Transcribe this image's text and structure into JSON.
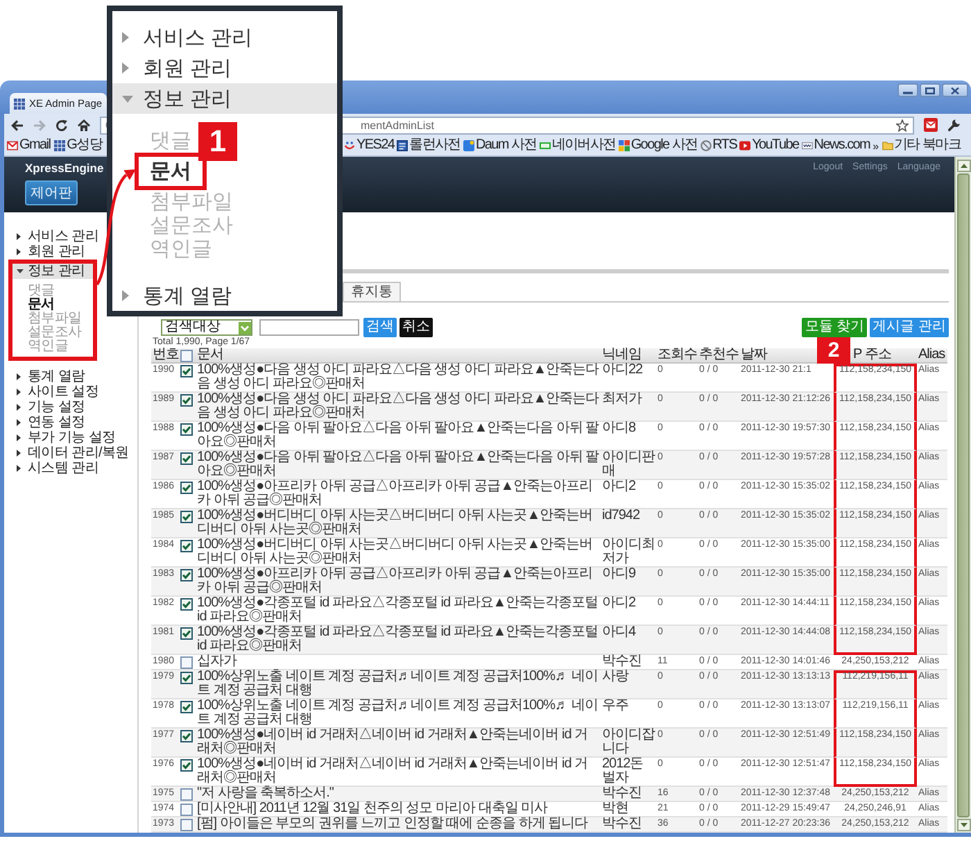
{
  "magnified_menu": {
    "callout": "1",
    "items": [
      {
        "label": "서비스 관리",
        "expanded": false
      },
      {
        "label": "회원 관리",
        "expanded": false
      },
      {
        "label": "정보 관리",
        "expanded": true,
        "children": [
          {
            "label": "댓글",
            "selected": false,
            "highlighted": false
          },
          {
            "label": "문서",
            "selected": true,
            "highlighted": true
          },
          {
            "label": "첨부파일",
            "selected": false,
            "highlighted": false
          },
          {
            "label": "설문조사",
            "selected": false,
            "highlighted": false
          },
          {
            "label": "역인글",
            "selected": false,
            "highlighted": false
          }
        ]
      },
      {
        "label": "통계 열람",
        "expanded": false
      }
    ]
  },
  "browser": {
    "tab_title": "XE Admin Page",
    "address": "mentAdminList",
    "bookmarks_left": [
      {
        "label": "Gmail",
        "kind": "mail"
      },
      {
        "label": "G성당",
        "kind": "grid"
      }
    ],
    "bookmarks_right": [
      {
        "label": "YES24",
        "kind": "smile"
      },
      {
        "label": "롤런사전",
        "kind": "book"
      },
      {
        "label": "Daum 사전",
        "kind": "tile"
      },
      {
        "label": "네이버사전",
        "kind": "bar"
      },
      {
        "label": "Google 사전",
        "kind": "squares"
      },
      {
        "label": "RTS",
        "kind": "ring"
      },
      {
        "label": "YouTube",
        "kind": "play"
      },
      {
        "label": "News.com",
        "kind": "card"
      }
    ],
    "overflow": "»",
    "other_bookmarks": "기타 북마크"
  },
  "header": {
    "logo": "XpressEngine",
    "control_panel_button": "제어판",
    "links": [
      "Logout",
      "Settings",
      "Language"
    ]
  },
  "sidebar": {
    "items": [
      {
        "label": "서비스 관리",
        "expanded": false,
        "highlighted": false
      },
      {
        "label": "회원 관리",
        "expanded": false,
        "highlighted": false
      },
      {
        "label": "정보 관리",
        "expanded": true,
        "highlighted": true,
        "children": [
          {
            "label": "댓글",
            "selected": false
          },
          {
            "label": "문서",
            "selected": true
          },
          {
            "label": "첨부파일",
            "selected": false
          },
          {
            "label": "설문조사",
            "selected": false
          },
          {
            "label": "역인글",
            "selected": false
          }
        ]
      },
      {
        "label": "통계 열람",
        "expanded": false,
        "highlighted": false
      },
      {
        "label": "사이트 설정",
        "expanded": false,
        "highlighted": false
      },
      {
        "label": "기능 설정",
        "expanded": false,
        "highlighted": false
      },
      {
        "label": "연동 설정",
        "expanded": false,
        "highlighted": false
      },
      {
        "label": "부가 기능 설정",
        "expanded": false,
        "highlighted": false
      },
      {
        "label": "데이터 관리/복원",
        "expanded": false,
        "highlighted": false
      },
      {
        "label": "시스템 관리",
        "expanded": false,
        "highlighted": false
      }
    ]
  },
  "content": {
    "tabs": [
      {
        "label": "휴지통",
        "selected": false
      }
    ],
    "search_target": "검색대상",
    "search_button": "검색",
    "cancel_button": "취소",
    "action_buttons": [
      {
        "label": "모듈 찾기",
        "color": "#1f9a1f"
      },
      {
        "label": "게시글 관리",
        "color": "#2b8fe3"
      }
    ],
    "summary": "Total 1,990, Page 1/67"
  },
  "table": {
    "callout": "2",
    "select_all_checked": false,
    "columns": [
      "번호",
      "문서",
      "닉네임",
      "조회수",
      "추천수",
      "날짜",
      "P 주소",
      "Alias"
    ],
    "rows": [
      {
        "number": "1990",
        "checked": true,
        "title": "100%생성●다음 생성 아디 파라요△다음 생성 아디 파라요▲안죽는다음 생성 아디 파라요◎판매처",
        "nickname": "아디22",
        "views": "0",
        "votes": "0 / 0",
        "date": "2011-12-30 21:1",
        "ip": "112,158,234,150",
        "alias": "Alias",
        "ip_highlighted": true
      },
      {
        "number": "1989",
        "checked": true,
        "title": "100%생성●다음 생성 아디 파라요△다음 생성 아디 파라요▲안죽는다음 생성 아디 파라요◎판매처",
        "nickname": "최저가",
        "views": "0",
        "votes": "0 / 0",
        "date": "2011-12-30 21:12:26",
        "ip": "112,158,234,150",
        "alias": "Alias",
        "ip_highlighted": true
      },
      {
        "number": "1988",
        "checked": true,
        "title": "100%생성●다음 아뒤 팔아요△다음 아뒤 팔아요▲안죽는다음 아뒤 팔아요◎판매처",
        "nickname": "아디8",
        "views": "0",
        "votes": "0 / 0",
        "date": "2011-12-30 19:57:30",
        "ip": "112,158,234,150",
        "alias": "Alias",
        "ip_highlighted": true
      },
      {
        "number": "1987",
        "checked": true,
        "title": "100%생성●다음 아뒤 팔아요△다음 아뒤 팔아요▲안죽는다음 아뒤 팔아요◎판매처",
        "nickname": "아이디판매",
        "views": "0",
        "votes": "0 / 0",
        "date": "2011-12-30 19:57:28",
        "ip": "112,158,234,150",
        "alias": "Alias",
        "ip_highlighted": true
      },
      {
        "number": "1986",
        "checked": true,
        "title": "100%생성●아프리카 아뒤 공급△아프리카 아뒤 공급▲안죽는아프리카 아뒤 공급◎판매처",
        "nickname": "아디2",
        "views": "0",
        "votes": "0 / 0",
        "date": "2011-12-30 15:35:02",
        "ip": "112,158,234,150",
        "alias": "Alias",
        "ip_highlighted": true
      },
      {
        "number": "1985",
        "checked": true,
        "title": "100%생성●버디버디 아뒤 사는곳△버디버디 아뒤 사는곳▲안죽는버디버디 아뒤 사는곳◎판매처",
        "nickname": "id7942",
        "views": "0",
        "votes": "0 / 0",
        "date": "2011-12-30 15:35:02",
        "ip": "112,158,234,150",
        "alias": "Alias",
        "ip_highlighted": true
      },
      {
        "number": "1984",
        "checked": true,
        "title": "100%생성●버디버디 아뒤 사는곳△버디버디 아뒤 사는곳▲안죽는버디버디 아뒤 사는곳◎판매처",
        "nickname": "아이디최저가",
        "views": "0",
        "votes": "0 / 0",
        "date": "2011-12-30 15:35:00",
        "ip": "112,158,234,150",
        "alias": "Alias",
        "ip_highlighted": true
      },
      {
        "number": "1983",
        "checked": true,
        "title": "100%생성●아프리카 아뒤 공급△아프리카 아뒤 공급▲안죽는아프리카 아뒤 공급◎판매처",
        "nickname": "아디9",
        "views": "0",
        "votes": "0 / 0",
        "date": "2011-12-30 15:35:00",
        "ip": "112,158,234,150",
        "alias": "Alias",
        "ip_highlighted": true
      },
      {
        "number": "1982",
        "checked": true,
        "title": "100%생성●각종포털 id 파라요△각종포털 id 파라요▲안죽는각종포털 id 파라요◎판매처",
        "nickname": "아디2",
        "views": "0",
        "votes": "0 / 0",
        "date": "2011-12-30 14:44:11",
        "ip": "112,158,234,150",
        "alias": "Alias",
        "ip_highlighted": true
      },
      {
        "number": "1981",
        "checked": true,
        "title": "100%생성●각종포털 id 파라요△각종포털 id 파라요▲안죽는각종포털 id 파라요◎판매처",
        "nickname": "아디4",
        "views": "0",
        "votes": "0 / 0",
        "date": "2011-12-30 14:44:08",
        "ip": "112,158,234,150",
        "alias": "Alias",
        "ip_highlighted": true
      },
      {
        "number": "1980",
        "checked": false,
        "title": "십자가",
        "nickname": "박수진",
        "views": "11",
        "votes": "0 / 0",
        "date": "2011-12-30 14:01:46",
        "ip": "24,250,153,212",
        "alias": "Alias",
        "ip_highlighted": false
      },
      {
        "number": "1979",
        "checked": true,
        "title": "100%상위노출 네이트 계정 공급처♬네이트 계정 공급처100%♬ 네이트 계정 공급처 대행",
        "nickname": "사랑",
        "views": "0",
        "votes": "0 / 0",
        "date": "2011-12-30 13:13:13",
        "ip": "112,219,156,11",
        "alias": "Alias",
        "ip_highlighted": true
      },
      {
        "number": "1978",
        "checked": true,
        "title": "100%상위노출 네이트 계정 공급처♬네이트 계정 공급처100%♬ 네이트 계정 공급처 대행",
        "nickname": "우주",
        "views": "0",
        "votes": "0 / 0",
        "date": "2011-12-30 13:13:07",
        "ip": "112,219,156,11",
        "alias": "Alias",
        "ip_highlighted": true
      },
      {
        "number": "1977",
        "checked": true,
        "title": "100%생성●네이버 id 거래처△네이버 id 거래처▲안죽는네이버 id 거래처◎판매처",
        "nickname": "아이디잡니다",
        "views": "0",
        "votes": "0 / 0",
        "date": "2011-12-30 12:51:49",
        "ip": "112,158,234,150",
        "alias": "Alias",
        "ip_highlighted": true
      },
      {
        "number": "1976",
        "checked": true,
        "title": "100%생성●네이버 id 거래처△네이버 id 거래처▲안죽는네이버 id 거래처◎판매처",
        "nickname": "2012돈벌자",
        "views": "0",
        "votes": "0 / 0",
        "date": "2011-12-30 12:51:47",
        "ip": "112,158,234,150",
        "alias": "Alias",
        "ip_highlighted": true
      },
      {
        "number": "1975",
        "checked": false,
        "title": "\"저 사랑을 축복하소서.\"",
        "nickname": "박수진",
        "views": "16",
        "votes": "0 / 0",
        "date": "2011-12-30 12:37:48",
        "ip": "24,250,153,212",
        "alias": "Alias",
        "ip_highlighted": false
      },
      {
        "number": "1974",
        "checked": false,
        "title": "[미사안내] 2011년 12월 31일 천주의 성모 마리아 대축일 미사",
        "nickname": "박현",
        "views": "21",
        "votes": "0 / 0",
        "date": "2011-12-29 15:49:47",
        "ip": "24,250,246,91",
        "alias": "Alias",
        "ip_highlighted": false
      },
      {
        "number": "1973",
        "checked": false,
        "title": "[펌] 아이들은 부모의 권위를 느끼고 인정할 때에 순종을 하게 됩니다",
        "nickname": "박수진",
        "views": "36",
        "votes": "0 / 0",
        "date": "2011-12-27 20:23:36",
        "ip": "24,250,153,212",
        "alias": "Alias",
        "ip_highlighted": false
      }
    ]
  }
}
